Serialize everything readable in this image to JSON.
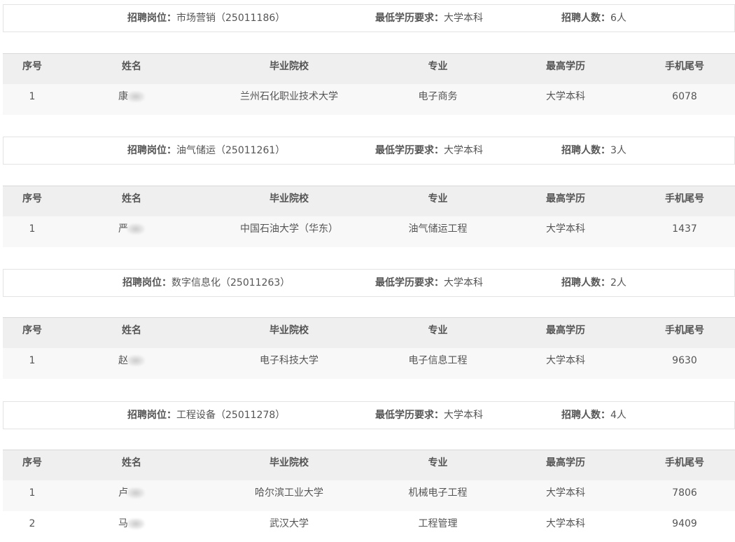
{
  "labels": {
    "position_key": "招聘岗位：",
    "edu_key": "最低学历要求：",
    "count_key": "招聘人数：",
    "columns": [
      "序号",
      "姓名",
      "毕业院校",
      "专业",
      "最高学历",
      "手机尾号"
    ]
  },
  "sections": [
    {
      "position": "市场营销（25011186）",
      "min_education": "大学本科",
      "count": "6人",
      "rows": [
        {
          "no": "1",
          "name": "康",
          "school": "兰州石化职业技术大学",
          "major": "电子商务",
          "degree": "大学本科",
          "phone_tail": "6078"
        }
      ]
    },
    {
      "position": "油气储运（25011261）",
      "min_education": "大学本科",
      "count": "3人",
      "rows": [
        {
          "no": "1",
          "name": "严",
          "school": "中国石油大学（华东）",
          "major": "油气储运工程",
          "degree": "大学本科",
          "phone_tail": "1437"
        }
      ]
    },
    {
      "position": "数字信息化（25011263）",
      "min_education": "大学本科",
      "count": "2人",
      "rows": [
        {
          "no": "1",
          "name": "赵",
          "school": "电子科技大学",
          "major": "电子信息工程",
          "degree": "大学本科",
          "phone_tail": "9630"
        }
      ]
    },
    {
      "position": "工程设备（25011278）",
      "min_education": "大学本科",
      "count": "4人",
      "rows": [
        {
          "no": "1",
          "name": "卢",
          "school": "哈尔滨工业大学",
          "major": "机械电子工程",
          "degree": "大学本科",
          "phone_tail": "7806"
        },
        {
          "no": "2",
          "name": "马",
          "school": "武汉大学",
          "major": "工程管理",
          "degree": "大学本科",
          "phone_tail": "9409"
        }
      ]
    }
  ]
}
